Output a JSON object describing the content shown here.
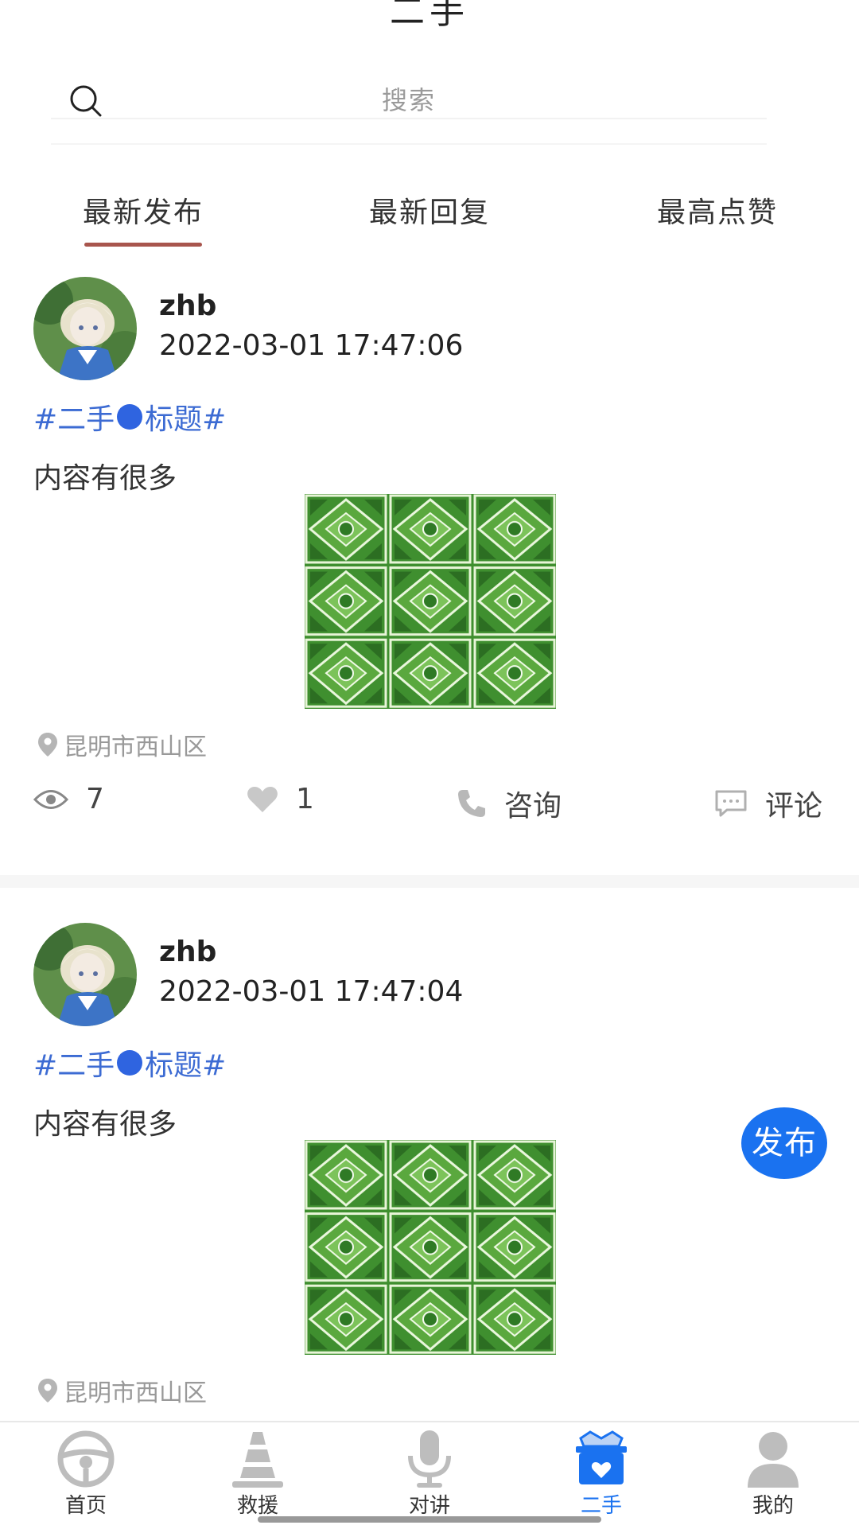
{
  "header": {
    "title": "二手"
  },
  "search": {
    "placeholder": "搜索"
  },
  "tabs": [
    {
      "label": "最新发布",
      "active": true
    },
    {
      "label": "最新回复",
      "active": false
    },
    {
      "label": "最高点赞",
      "active": false
    }
  ],
  "posts": [
    {
      "username": "zhb",
      "timestamp": "2022-03-01 17:47:06",
      "topic_prefix": "#二手",
      "topic_suffix": "标题#",
      "content": "内容有很多",
      "location": "昆明市西山区",
      "views": "7",
      "likes": "1",
      "consult_label": "咨询",
      "comment_label": "评论"
    },
    {
      "username": "zhb",
      "timestamp": "2022-03-01 17:47:04",
      "topic_prefix": "#二手",
      "topic_suffix": "标题#",
      "content": "内容有很多",
      "location": "昆明市西山区"
    }
  ],
  "fab": {
    "label": "发布"
  },
  "bottom_nav": [
    {
      "label": "首页",
      "icon": "steering-wheel-icon",
      "active": false
    },
    {
      "label": "救援",
      "icon": "traffic-cone-icon",
      "active": false
    },
    {
      "label": "对讲",
      "icon": "microphone-icon",
      "active": false
    },
    {
      "label": "二手",
      "icon": "heart-box-icon",
      "active": true
    },
    {
      "label": "我的",
      "icon": "user-icon",
      "active": false
    }
  ],
  "colors": {
    "accent": "#1a72f0",
    "topic": "#3c6bd3",
    "tab_underline": "#a8554d"
  }
}
